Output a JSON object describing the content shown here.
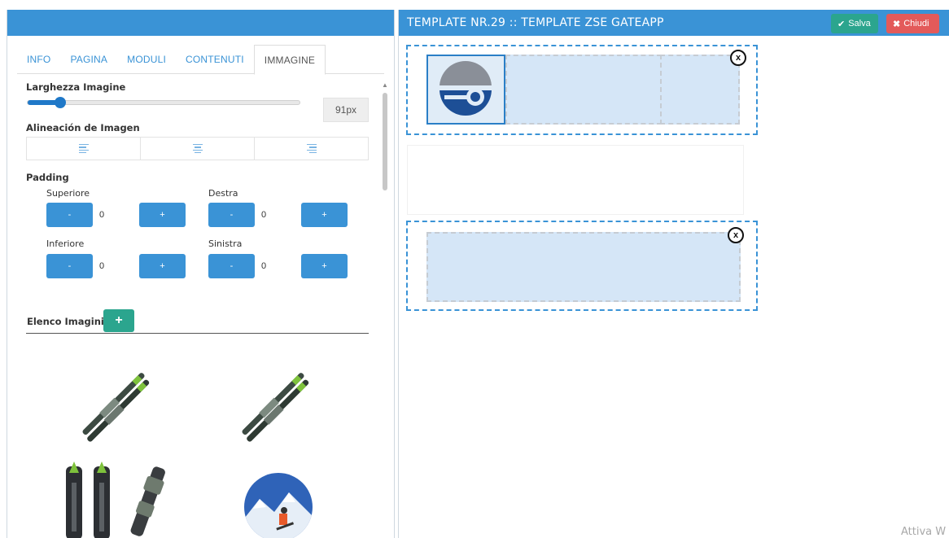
{
  "left": {
    "tabs": [
      {
        "label": "INFO"
      },
      {
        "label": "PAGINA"
      },
      {
        "label": "MODULI"
      },
      {
        "label": "CONTENUTI"
      },
      {
        "label": "IMMAGINE"
      }
    ],
    "larghezza_label": "Larghezza Imagine",
    "width_value": "91px",
    "width_fraction": 0.12,
    "alineacion_label": "Alineación de Imagen",
    "padding_label": "Padding",
    "padding": {
      "superiore_label": "Superiore",
      "superiore_value": "0",
      "destra_label": "Destra",
      "destra_value": "0",
      "inferiore_label": "Inferiore",
      "inferiore_value": "0",
      "sinistra_label": "Sinistra",
      "sinistra_value": "0",
      "minus": "-",
      "plus": "+"
    },
    "elenco_label": "Elenco Imagini",
    "add_label": "+"
  },
  "right": {
    "title": "TEMPLATE NR.29 :: TEMPLATE ZSE GATEAPP",
    "salva_label": "Salva",
    "chiudi_label": "Chiudi",
    "remove_label": "x"
  },
  "colors": {
    "header_blue": "#3a93d6",
    "salva_green": "#2ba58e",
    "chiudi_red": "#e35a5a"
  },
  "watermark": "Attiva W"
}
